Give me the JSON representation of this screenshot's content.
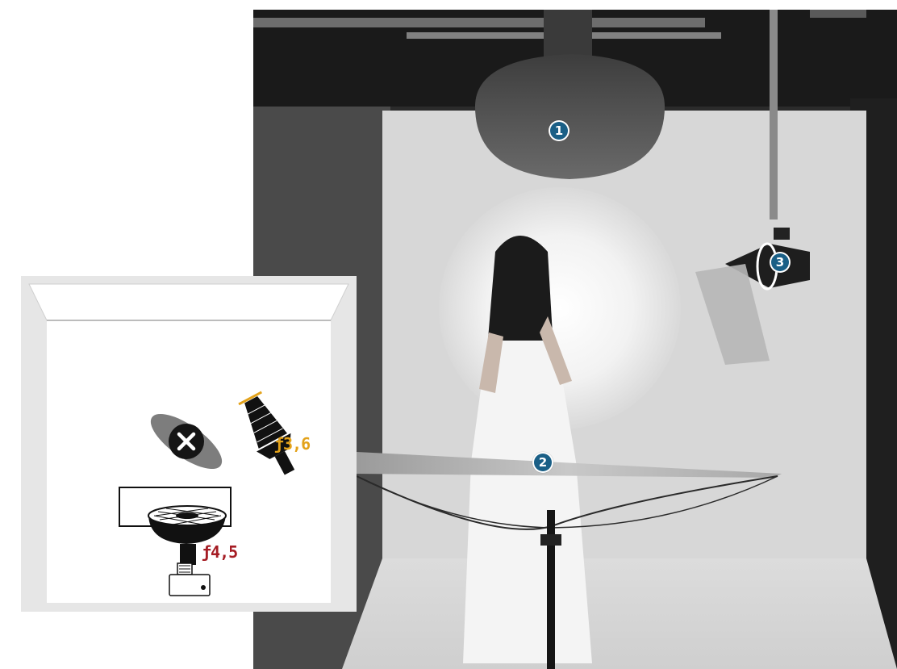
{
  "photo": {
    "subject": "studio-portrait-photo",
    "markers": [
      {
        "number": "1",
        "color": "#1a5f86"
      },
      {
        "number": "2",
        "color": "#1a5f86"
      },
      {
        "number": "3",
        "color": "#1a5f86"
      }
    ]
  },
  "diagram": {
    "background_color": "#e6e6e6",
    "icons": [
      "background-paper-icon",
      "beauty-dish-icon",
      "snoot-light-icon",
      "reflector-disabled-icon",
      "camera-icon",
      "table-icon"
    ],
    "fstops": [
      {
        "label": "ƒ3,6",
        "color": "#e3a21a"
      },
      {
        "label": "ƒ4,5",
        "color": "#a51c24"
      }
    ]
  }
}
